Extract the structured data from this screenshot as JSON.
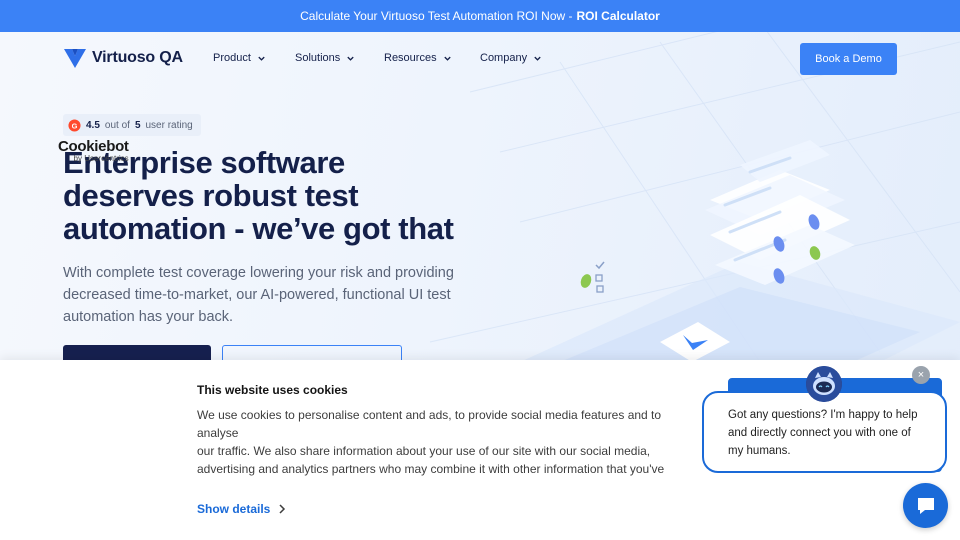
{
  "promo": {
    "text": "Calculate Your Virtuoso Test Automation ROI Now -",
    "link": "ROI Calculator"
  },
  "nav": {
    "logo_text": "Virtuoso QA",
    "items": [
      "Product",
      "Solutions",
      "Resources",
      "Company"
    ],
    "demo_button": "Book a Demo"
  },
  "rating": {
    "score": "4.5",
    "out_of": "out of",
    "max": "5",
    "label": "user rating"
  },
  "hero": {
    "headline": "Enterprise software deserves robust test automation - we’ve got that",
    "subtext": "With complete test coverage lowering your risk and providing decreased time-to-market, our AI-powered, functional UI test automation has your back."
  },
  "cookie": {
    "brand": "Cookiebot",
    "brand_sub": "by Usercentrics",
    "title": "This website uses cookies",
    "body": "We use cookies to personalise content and ads, to provide social media features and to analyse\nour traffic. We also share information about your use of our site with our social media,\nadvertising and analytics partners who may combine it with other information that you've\nprovided to them or that they've collected from your use of their services.",
    "show_details": "Show details"
  },
  "chat": {
    "message": "Got any questions? I'm happy to help and directly connect you with one of my humans.",
    "close": "×"
  },
  "colors": {
    "primary": "#3b82f6",
    "navy": "#14204a",
    "cookie_link": "#1a6ad8"
  }
}
